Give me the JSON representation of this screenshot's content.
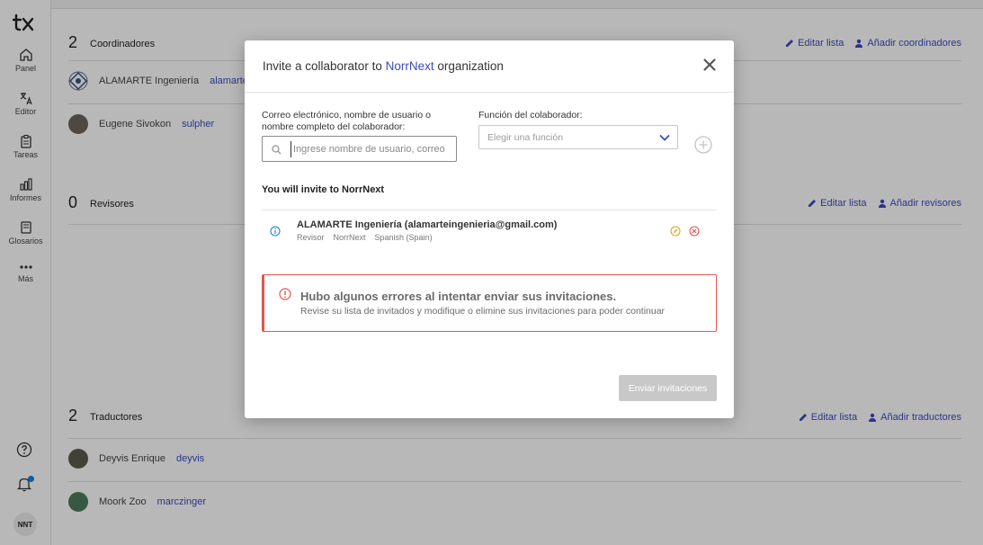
{
  "sidebar": {
    "logo": "tx-logo",
    "items": [
      {
        "label": "Panel",
        "icon": "home-icon"
      },
      {
        "label": "Editor",
        "icon": "translate-icon"
      },
      {
        "label": "Tareas",
        "icon": "clipboard-icon"
      },
      {
        "label": "Informes",
        "icon": "bar-chart-icon"
      },
      {
        "label": "Glosarios",
        "icon": "book-icon"
      },
      {
        "label": "Más",
        "icon": "more-icon"
      }
    ],
    "user_initials": "NNT"
  },
  "sections": {
    "coordinators": {
      "count": "2",
      "title": "Coordinadores",
      "edit_label": "Editar lista",
      "add_label": "Añadir coordinadores",
      "members": [
        {
          "name": "ALAMARTE Ingeniería",
          "username": "alamarte"
        },
        {
          "name": "Eugene Sivokon",
          "username": "sulpher"
        }
      ]
    },
    "reviewers": {
      "count": "0",
      "title": "Revisores",
      "edit_label": "Editar lista",
      "add_label": "Añadir revisores"
    },
    "translators": {
      "count": "2",
      "title": "Traductores",
      "edit_label": "Editar lista",
      "add_label": "Añadir traductores",
      "members": [
        {
          "name": "Deyvis Enrique",
          "username": "deyvis"
        },
        {
          "name": "Moork Zoo",
          "username": "marczinger"
        }
      ]
    }
  },
  "modal": {
    "title_prefix": "Invite a collaborator to",
    "org_name": "NorrNext",
    "title_suffix": "organization",
    "user_field_label": "Correo electrónico, nombre de usuario o nombre completo del colaborador:",
    "user_field_placeholder": "Ingrese nombre de usuario, correo",
    "role_field_label": "Función del colaborador:",
    "role_placeholder": "Elegir una función",
    "invite_heading": "You will invite to NorrNext",
    "invitee": {
      "name": "ALAMARTE Ingeniería (alamarteingenieria@gmail.com)",
      "role": "Revisor",
      "org": "NorrNext",
      "language": "Spanish (Spain)"
    },
    "error_title": "Hubo algunos errores al intentar enviar sus invitaciones.",
    "error_text": "Revise su lista de invitados y modifique o elimine sus invitaciones para poder continuar",
    "send_label": "Enviar invitaciones"
  },
  "colors": {
    "accent": "#3b4bc0",
    "error": "#e0564f",
    "disabled_button": "#c8c8c8"
  }
}
